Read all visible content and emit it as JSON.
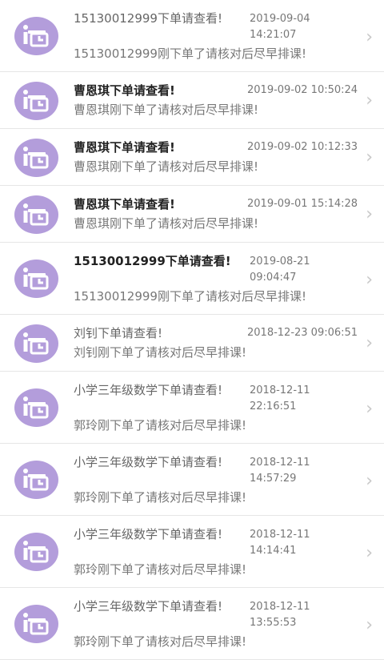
{
  "notifications": [
    {
      "title": "15130012999下单请查看!",
      "bold": false,
      "time": "2019-09-04 14:21:07",
      "desc": "15130012999刚下单了请核对后尽早排课!"
    },
    {
      "title": "曹恩琪下单请查看!",
      "bold": true,
      "time": "2019-09-02 10:50:24",
      "desc": "曹恩琪刚下单了请核对后尽早排课!"
    },
    {
      "title": "曹恩琪下单请查看!",
      "bold": true,
      "time": "2019-09-02 10:12:33",
      "desc": "曹恩琪刚下单了请核对后尽早排课!"
    },
    {
      "title": "曹恩琪下单请查看!",
      "bold": true,
      "time": "2019-09-01 15:14:28",
      "desc": "曹恩琪刚下单了请核对后尽早排课!"
    },
    {
      "title": "15130012999下单请查看!",
      "bold": true,
      "time": "2019-08-21 09:04:47",
      "desc": "15130012999刚下单了请核对后尽早排课!"
    },
    {
      "title": "刘钊下单请查看!",
      "bold": false,
      "time": "2018-12-23 09:06:51",
      "desc": "刘钊刚下单了请核对后尽早排课!"
    },
    {
      "title": "小学三年级数学下单请查看!",
      "bold": false,
      "time": "2018-12-11 22:16:51",
      "desc": "郭玲刚下单了请核对后尽早排课!"
    },
    {
      "title": "小学三年级数学下单请查看!",
      "bold": false,
      "time": "2018-12-11 14:57:29",
      "desc": "郭玲刚下单了请核对后尽早排课!"
    },
    {
      "title": "小学三年级数学下单请查看!",
      "bold": false,
      "time": "2018-12-11 14:14:41",
      "desc": "郭玲刚下单了请核对后尽早排课!"
    },
    {
      "title": "小学三年级数学下单请查看!",
      "bold": false,
      "time": "2018-12-11 13:55:53",
      "desc": "郭玲刚下单了请核对后尽早排课!"
    }
  ],
  "icons": {
    "avatar": "person-clock-icon",
    "chevron": "chevron-right-icon"
  },
  "colors": {
    "avatar_bg": "#b39ddb",
    "divider": "#e6e6e6"
  },
  "glyphs": {
    "chevron": "›"
  }
}
